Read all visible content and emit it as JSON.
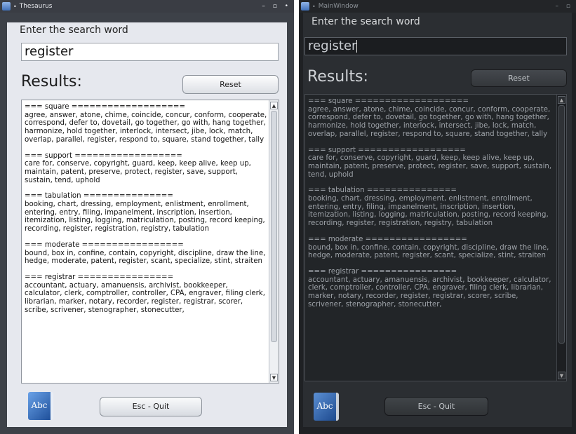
{
  "light_window": {
    "title": "Thesaurus",
    "window_controls": "– ▫ •"
  },
  "dark_window": {
    "title": "MainWindow",
    "window_controls": "– ▫"
  },
  "search": {
    "prompt": "Enter the search word",
    "value": "register"
  },
  "results_label": "Results:",
  "reset_label": "Reset",
  "quit_label": "Esc - Quit",
  "logo_text": "Abc",
  "entries": [
    {
      "header": "=== square ===================",
      "body": "agree, answer, atone, chime, coincide, concur, conform, cooperate, correspond, defer to, dovetail, go together, go with, hang together, harmonize, hold together, interlock, intersect, jibe, lock, match, overlap, parallel, register, respond to, square, stand together, tally"
    },
    {
      "header": "=== support ==================",
      "body": "care for, conserve, copyright, guard, keep, keep alive, keep up, maintain, patent, preserve, protect, register, save, support, sustain, tend, uphold"
    },
    {
      "header": "=== tabulation ===============",
      "body": "booking, chart, dressing, employment, enlistment, enrollment, entering, entry, filing, impanelment, inscription, insertion, itemization, listing, logging, matriculation, posting, record keeping, recording, register, registration, registry, tabulation"
    },
    {
      "header": "=== moderate =================",
      "body": "bound, box in, confine, contain, copyright, discipline, draw the line, hedge, moderate, patent, register, scant, specialize, stint, straiten"
    },
    {
      "header": "=== registrar ================",
      "body": "accountant, actuary, amanuensis, archivist, bookkeeper, calculator, clerk, comptroller, controller, CPA, engraver, filing clerk, librarian, marker, notary, recorder, register, registrar, scorer, scribe, scrivener, stenographer, stonecutter,"
    }
  ]
}
